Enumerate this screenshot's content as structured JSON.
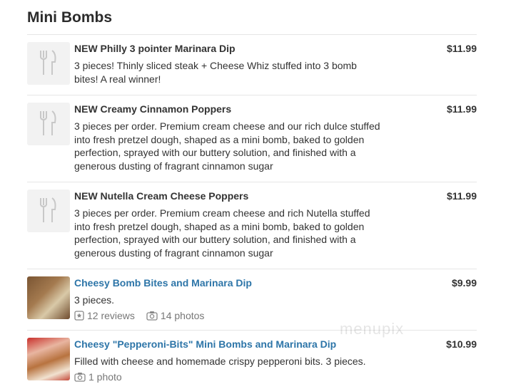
{
  "section": {
    "title": "Mini Bombs"
  },
  "items": [
    {
      "name": "NEW Philly 3 pointer Marinara Dip",
      "price": "$11.99",
      "description": "3 pieces! Thinly sliced steak + Cheese Whiz stuffed into 3 bomb bites! A real winner!",
      "thumbnail": "utensils-placeholder-icon"
    },
    {
      "name": "NEW Creamy Cinnamon Poppers",
      "price": "$11.99",
      "description": "3 pieces per order. Premium cream cheese and our rich dulce stuffed into fresh pretzel dough, shaped as a mini bomb, baked to golden perfection, sprayed with our buttery solution, and finished with a generous dusting of fragrant cinnamon sugar",
      "thumbnail": "utensils-placeholder-icon"
    },
    {
      "name": "NEW Nutella Cream Cheese Poppers",
      "price": "$11.99",
      "description": "3 pieces per order. Premium cream cheese and rich Nutella stuffed into fresh pretzel dough, shaped as a mini bomb, baked to golden perfection, sprayed with our buttery solution, and finished with a generous dusting of fragrant cinnamon sugar",
      "thumbnail": "utensils-placeholder-icon"
    },
    {
      "name": "Cheesy Bomb Bites and Marinara Dip",
      "price": "$9.99",
      "description": "3 pieces.",
      "reviews": "12 reviews",
      "photos": "14 photos",
      "thumbnail": "food-photo"
    },
    {
      "name": "Cheesy \"Pepperoni-Bits\" Mini Bombs and Marinara Dip",
      "price": "$10.99",
      "description": "Filled with cheese and homemade crispy pepperoni bits. 3 pieces.",
      "photos": "1 photo",
      "thumbnail": "food-photo"
    }
  ],
  "watermark": "menupix",
  "colors": {
    "link": "#2d75a8",
    "text": "#333333",
    "muted": "#777777",
    "divider": "#e6e6e6"
  }
}
